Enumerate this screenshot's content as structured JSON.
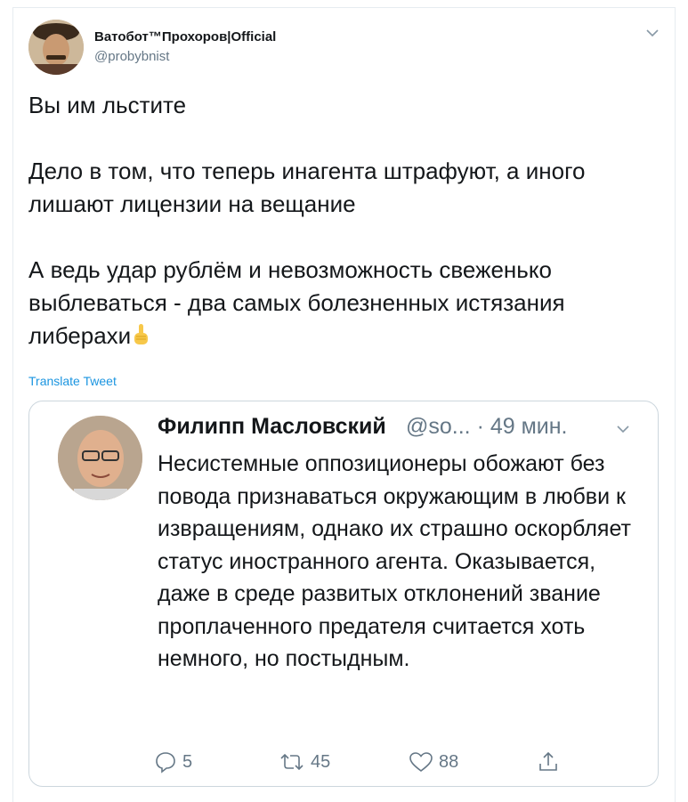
{
  "tweet": {
    "display_name": "Ватобот™Прохоров|Official",
    "handle": "@probybnist",
    "paragraphs": [
      "Вы им льстите",
      "Дело в том, что теперь инагента штрафуют, а иного лишают лицензии на вещание",
      "А ведь удар рублём и невозможность свеженько выблеваться - два самых болезненных истязания либерахи"
    ],
    "emoji": "pointing-up-icon",
    "translate_label": "Translate Tweet"
  },
  "quoted": {
    "display_name": "Филипп Масловский",
    "handle_time": "@so... · 49 мин.",
    "text": "Несистемные оппозиционеры обожают без повода признаваться окружающим в любви к извращениям, однако их страшно оскорбляет статус иностранного агента. Оказывается, даже в среде развитых отклонений звание проплаченного предателя считается хоть немного, но постыдным.",
    "replies": "5",
    "retweets": "45",
    "likes": "88"
  },
  "colors": {
    "text": "#14171a",
    "secondary": "#657786",
    "link": "#1b95e0",
    "border": "#ccd6dd"
  }
}
